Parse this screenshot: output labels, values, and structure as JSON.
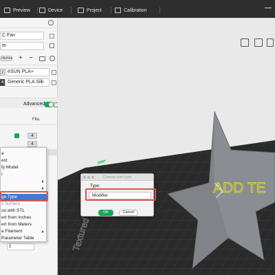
{
  "topbar": {
    "menus": [
      {
        "label": "Preview",
        "icon": "preview-icon"
      },
      {
        "label": "Device",
        "icon": "device-icon"
      },
      {
        "label": "Project",
        "icon": "project-icon"
      },
      {
        "label": "Calibration",
        "icon": "calibration-icon"
      }
    ]
  },
  "left_panel": {
    "fan_field": "C Fan",
    "te_field": "te",
    "volumes_label": "olumes",
    "filaments": [
      {
        "index": "2",
        "name": "eSUN PLA+"
      },
      {
        "index": "4",
        "name": "Generic PLA Silk"
      }
    ],
    "advanced_label": "Advanced",
    "fila_header": "Fila.",
    "fila_values": [
      "4",
      "4"
    ],
    "bottom_value": "2"
  },
  "context_menu": {
    "items": [
      {
        "label": "e",
        "has_submenu": false
      },
      {
        "label": "ext",
        "has_submenu": false
      },
      {
        "label": "fy Model",
        "has_submenu": false
      },
      {
        "label": "r",
        "has_submenu": false
      },
      {
        "label": "",
        "has_submenu": true
      },
      {
        "label": "",
        "has_submenu": true
      },
      {
        "label": "ge Type",
        "has_submenu": false,
        "highlighted": true
      },
      {
        "label": "ll Surface",
        "has_submenu": false
      },
      {
        "label": "ce with STL",
        "has_submenu": false
      },
      {
        "label": "ert from Inches",
        "has_submenu": false
      },
      {
        "label": "ert from Meters",
        "has_submenu": false
      },
      {
        "label": "e Filament",
        "has_submenu": true
      },
      {
        "label": "Parameter Table",
        "has_submenu": false
      }
    ]
  },
  "dialog": {
    "title": "Choose part type",
    "type_label": "Type:",
    "selected_type": "Modifier",
    "ok_label": "OK",
    "cancel_label": "Cancel"
  },
  "viewport": {
    "model_text": "ADD TE",
    "plate_text": "Textured PEI Pl"
  },
  "colors": {
    "accent_green": "#19a55b",
    "highlight_blue": "#3a7bd5",
    "red_annotation": "#d9534f",
    "model_grey": "#8a8d92",
    "model_text_yellow": "#d7d72a"
  }
}
